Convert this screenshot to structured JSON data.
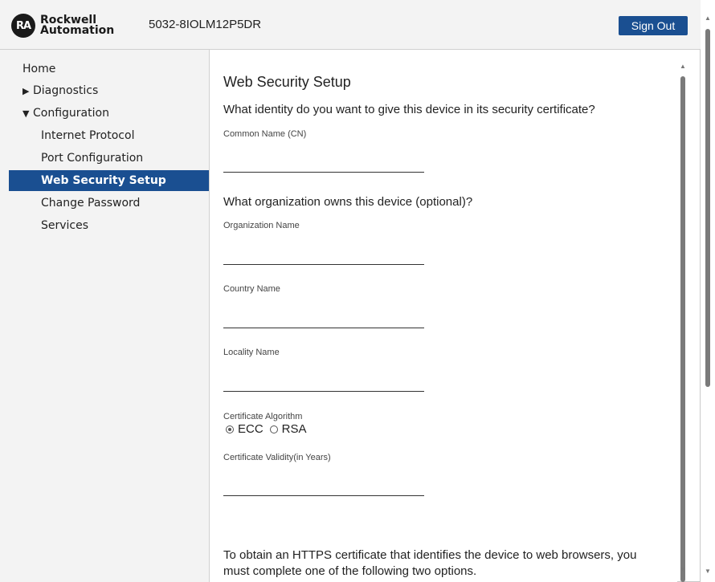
{
  "header": {
    "logo_mark": "RA",
    "logo_line1": "Rockwell",
    "logo_line2": "Automation",
    "device_name": "5032-8IOLM12P5DR",
    "sign_out": "Sign Out",
    "accent_color": "#1a4f91"
  },
  "sidebar": {
    "home": "Home",
    "diagnostics": {
      "arrow": "▶",
      "label": "Diagnostics"
    },
    "configuration": {
      "arrow": "▼",
      "label": "Configuration"
    },
    "items": [
      {
        "label": "Internet Protocol"
      },
      {
        "label": "Port Configuration"
      },
      {
        "label": "Web Security Setup",
        "active": true
      },
      {
        "label": "Change Password"
      },
      {
        "label": "Services"
      }
    ]
  },
  "main": {
    "title": "Web Security Setup",
    "identity_question": "What identity do you want to give this device in its security certificate?",
    "common_name_label": "Common Name (CN)",
    "common_name_value": "",
    "org_question": "What organization owns this device (optional)?",
    "org_name_label": "Organization Name",
    "org_name_value": "",
    "country_label": "Country Name",
    "country_value": "",
    "locality_label": "Locality Name",
    "locality_value": "",
    "algorithm_label": "Certificate Algorithm",
    "algorithm_options": [
      "ECC",
      "RSA"
    ],
    "algorithm_selected": "ECC",
    "validity_label": "Certificate Validity(in Years)",
    "validity_value": "",
    "https_paragraph": "To obtain an HTTPS certificate that identifies the device to web browsers, you must complete one of the following two options."
  }
}
